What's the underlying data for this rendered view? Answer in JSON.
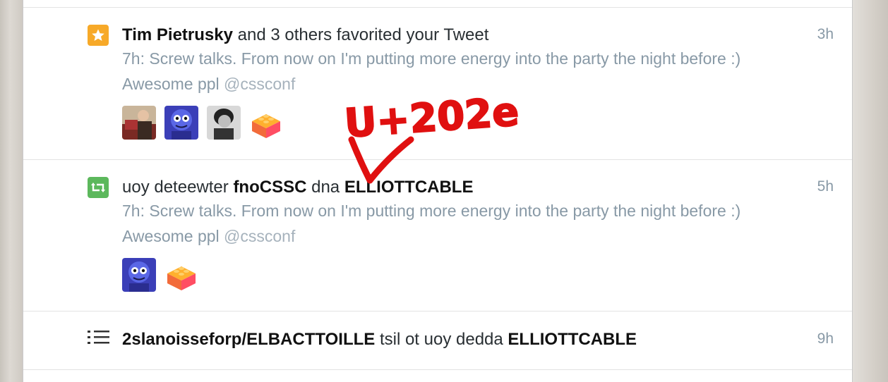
{
  "notifications": [
    {
      "type": "favorite",
      "icon": "star-icon",
      "actor": "Tim Pietrusky",
      "action": " and 3 others favorited your Tweet",
      "time": "3h",
      "tweet_text": "7h: Screw talks. From now on I'm putting more energy into the party the night before :) Awesome ppl ",
      "tweet_mention": "@cssconf",
      "avatars": [
        "avatar-photo-man",
        "avatar-blue-robot",
        "avatar-bw-portrait",
        "avatar-lego-brick"
      ]
    },
    {
      "type": "retweet",
      "icon": "retweet-icon",
      "prefix": "uoy deteewter ",
      "actor1": "fnoCSSC",
      "middle": " dna ",
      "actor2": "ELLIOTTCABLE",
      "time": "5h",
      "tweet_text": "7h: Screw talks. From now on I'm putting more energy into the party the night before :) Awesome ppl ",
      "tweet_mention": "@cssconf",
      "avatars": [
        "avatar-blue-robot",
        "avatar-lego-brick"
      ]
    },
    {
      "type": "list",
      "icon": "list-icon",
      "list_name": "2slanoisseforp/ELBACTTOILLE",
      "middle": " tsil ot uoy dedda ",
      "actor": "ELLIOTTCABLE",
      "time": "9h"
    }
  ],
  "annotation": {
    "text": "U+202e",
    "color": "#e01010"
  },
  "colors": {
    "favorite": "#f7a928",
    "retweet": "#5cb85c",
    "muted": "#8899a6"
  }
}
